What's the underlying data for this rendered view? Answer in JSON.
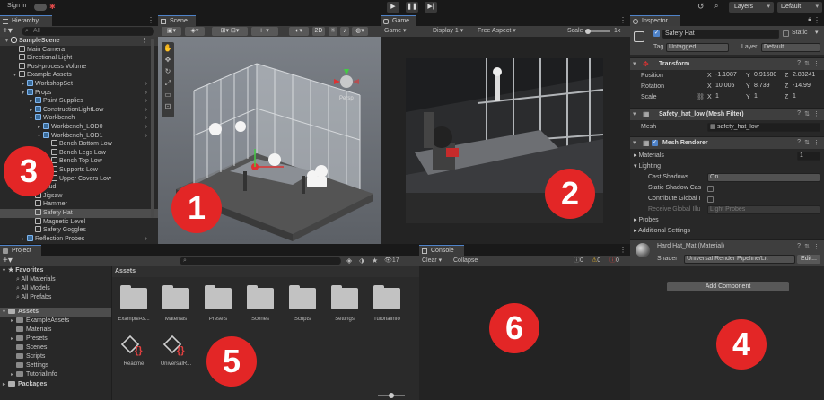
{
  "top_bar": {
    "sign_in": "Sign in",
    "layers": "Layers",
    "layout": "Default"
  },
  "hierarchy": {
    "tab": "Hierarchy",
    "search_placeholder": "All",
    "items": [
      {
        "label": "SampleScene",
        "depth": 0,
        "icon": "scene-icon"
      },
      {
        "label": "Main Camera",
        "depth": 1
      },
      {
        "label": "Directional Light",
        "depth": 1
      },
      {
        "label": "Post-process Volume",
        "depth": 1
      },
      {
        "label": "Example Assets",
        "depth": 1
      },
      {
        "label": "WorkshopSet",
        "depth": 2
      },
      {
        "label": "Props",
        "depth": 2
      },
      {
        "label": "Paint Supplies",
        "depth": 3
      },
      {
        "label": "ConstructionLightLow",
        "depth": 3
      },
      {
        "label": "Workbench",
        "depth": 3
      },
      {
        "label": "Workbench_LOD0",
        "depth": 4
      },
      {
        "label": "Workbench_LOD1",
        "depth": 4
      },
      {
        "label": "Bench Bottom Low",
        "depth": 5
      },
      {
        "label": "Bench Legs Low",
        "depth": 5
      },
      {
        "label": "Bench Top Low",
        "depth": 5
      },
      {
        "label": "Supports Low",
        "depth": 5
      },
      {
        "label": "Upper Covers Low",
        "depth": 5
      },
      {
        "label": "Stud",
        "depth": 3
      },
      {
        "label": "Jigsaw",
        "depth": 3
      },
      {
        "label": "Hammer",
        "depth": 3
      },
      {
        "label": "Safety Hat",
        "depth": 3
      },
      {
        "label": "Magnetic Level",
        "depth": 3
      },
      {
        "label": "Safety Goggles",
        "depth": 3
      },
      {
        "label": "Reflection Probes",
        "depth": 2
      }
    ]
  },
  "scene": {
    "tab": "Scene",
    "mode_2d": "2D",
    "persp_label": "Persp"
  },
  "game": {
    "tab": "Game",
    "mode": "Game",
    "display": "Display 1",
    "aspect": "Free Aspect",
    "scale_label": "Scale",
    "scale_value": "1x"
  },
  "inspector": {
    "tab": "Inspector",
    "object_name": "Safety Hat",
    "static_label": "Static",
    "tag_label": "Tag",
    "tag_value": "Untagged",
    "layer_label": "Layer",
    "layer_value": "Default",
    "transform": {
      "title": "Transform",
      "position_label": "Position",
      "rotation_label": "Rotation",
      "scale_label": "Scale",
      "position": {
        "x": "-1.1087",
        "y": "0.91580",
        "z": "2.83241"
      },
      "rotation": {
        "x": "10.005",
        "y": "8.739",
        "z": "-14.99"
      },
      "scale": {
        "x": "1",
        "y": "1",
        "z": "1"
      }
    },
    "mesh_filter": {
      "title": "Safety_hat_low (Mesh Filter)",
      "mesh_label": "Mesh",
      "mesh_value": "safety_hat_low"
    },
    "mesh_renderer": {
      "title": "Mesh Renderer",
      "materials_label": "Materials",
      "materials_count": "1",
      "lighting_label": "Lighting",
      "cast_shadows_label": "Cast Shadows",
      "cast_shadows_value": "On",
      "static_shadow_label": "Static Shadow Cas",
      "contribute_gi_label": "Contribute Global I",
      "receive_gi_label": "Receive Global Illu",
      "receive_gi_value": "Light Probes",
      "probes_label": "Probes",
      "additional_label": "Additional Settings"
    },
    "material": {
      "title": "Hard Hat_Mat (Material)",
      "shader_label": "Shader",
      "shader_value": "Universal Render Pipeline/Lit",
      "edit_label": "Edit..."
    },
    "add_component": "Add Component"
  },
  "project": {
    "tab": "Project",
    "favorites_label": "Favorites",
    "favorites": [
      "All Materials",
      "All Models",
      "All Prefabs"
    ],
    "assets_label": "Assets",
    "tree": [
      {
        "label": "ExampleAssets",
        "depth": 1
      },
      {
        "label": "Materials",
        "depth": 1
      },
      {
        "label": "Presets",
        "depth": 1
      },
      {
        "label": "Scenes",
        "depth": 1
      },
      {
        "label": "Scripts",
        "depth": 1
      },
      {
        "label": "Settings",
        "depth": 1
      },
      {
        "label": "TutorialInfo",
        "depth": 1
      }
    ],
    "packages_label": "Packages",
    "breadcrumb": "Assets",
    "hidden_count": "17",
    "grid": [
      {
        "name": "ExampleAs...",
        "kind": "folder"
      },
      {
        "name": "Materials",
        "kind": "folder"
      },
      {
        "name": "Presets",
        "kind": "folder"
      },
      {
        "name": "Scenes",
        "kind": "folder"
      },
      {
        "name": "Scripts",
        "kind": "folder"
      },
      {
        "name": "Settings",
        "kind": "folder"
      },
      {
        "name": "TutorialInfo",
        "kind": "folder"
      },
      {
        "name": "Readme",
        "kind": "script-asset"
      },
      {
        "name": "UniversalR...",
        "kind": "script-asset"
      }
    ]
  },
  "console": {
    "tab": "Console",
    "clear": "Clear",
    "collapse": "Collapse",
    "count_log": "0",
    "count_warn": "0",
    "count_err": "0"
  },
  "callouts": [
    "1",
    "2",
    "3",
    "4",
    "5",
    "6"
  ],
  "colors": {
    "selection": "#2c5d87",
    "callout": "#e32626",
    "accent": "#4f83c9"
  }
}
